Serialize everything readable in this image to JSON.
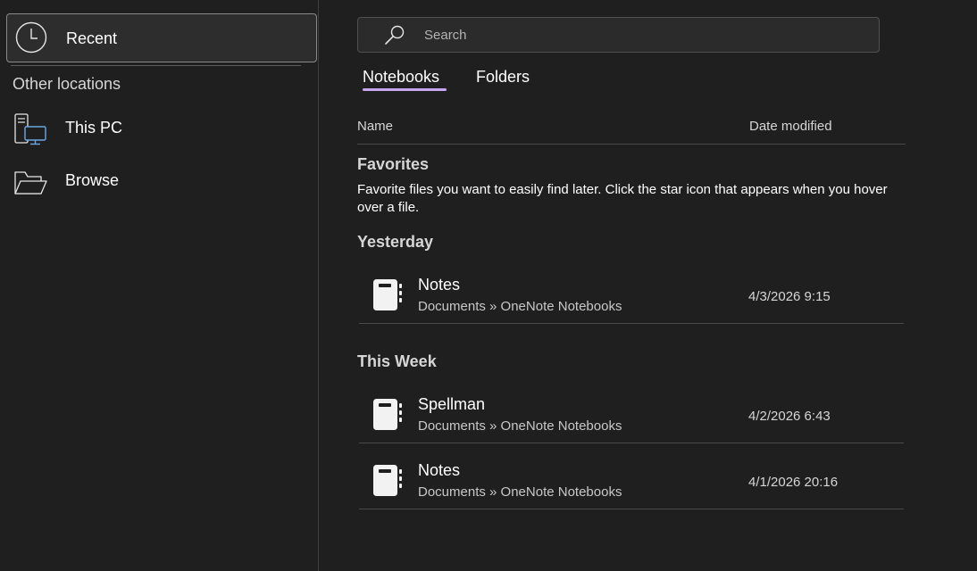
{
  "sidebar": {
    "recent_label": "Recent",
    "section_heading": "Other locations",
    "items": [
      {
        "label": "This PC",
        "icon": "computer-icon"
      },
      {
        "label": "Browse",
        "icon": "folder-open-icon"
      }
    ]
  },
  "search": {
    "placeholder": "Search",
    "value": ""
  },
  "tabs": [
    {
      "label": "Notebooks",
      "selected": true
    },
    {
      "label": "Folders",
      "selected": false
    }
  ],
  "columns": {
    "name": "Name",
    "date_modified": "Date modified"
  },
  "favorites": {
    "heading": "Favorites",
    "description": "Favorite files you want to easily find later. Click the star icon that appears when you hover over a file."
  },
  "groups": [
    {
      "heading": "Yesterday",
      "files": [
        {
          "name": "Notes",
          "path": "Documents » OneNote Notebooks",
          "date": "4/3/2026 9:15"
        }
      ]
    },
    {
      "heading": "This Week",
      "files": [
        {
          "name": "Spellman",
          "path": "Documents » OneNote Notebooks",
          "date": "4/2/2026 6:43"
        },
        {
          "name": "Notes",
          "path": "Documents » OneNote Notebooks",
          "date": "4/1/2026 20:16"
        }
      ]
    }
  ],
  "colors": {
    "background": "#1f1f1f",
    "selected_item": "#2d2d2d",
    "tab_accent": "#c7a8f0",
    "pc_screen_accent": "#6aa7e6"
  }
}
